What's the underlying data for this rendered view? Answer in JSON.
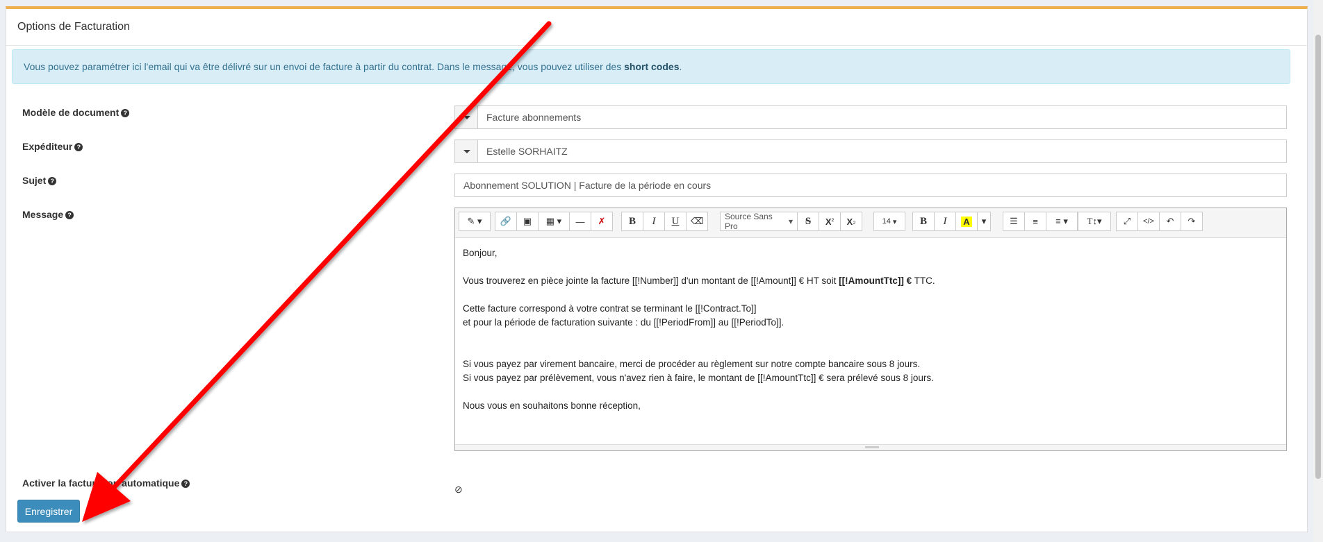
{
  "panel": {
    "title": "Options de Facturation"
  },
  "alert": {
    "text": "Vous pouvez paramétrer ici l'email qui va être délivré sur un envoi de facture à partir du contrat. Dans le message, vous pouvez utiliser des",
    "link": "short codes",
    "end": "."
  },
  "form": {
    "modele_label": "Modèle de document",
    "modele_value": "Facture abonnements",
    "expediteur_label": "Expéditeur",
    "expediteur_value": "Estelle SORHAITZ",
    "sujet_label": "Sujet",
    "sujet_value": "Abonnement SOLUTION | Facture de la période en cours",
    "message_label": "Message",
    "auto_label": "Activer la facturation automatique",
    "auto_icon": "ban-icon",
    "save_label": "Enregistrer"
  },
  "toolbar": {
    "font_name": "Source Sans Pro",
    "font_size": "14",
    "bold": "B",
    "italic": "I",
    "underline": "U",
    "strike": "S",
    "highlight": "A",
    "text_height": "T↕"
  },
  "message": {
    "line1": "Bonjour,",
    "line2_a": "Vous trouverez en pièce jointe la facture [[!Number]] d'un montant de  [[!Amount]] € HT soit ",
    "line2_b": "[[!AmountTtc]] €",
    "line2_c": " TTC.",
    "line3": "Cette facture correspond à votre contrat se terminant le [[!Contract.To]]",
    "line4": "et pour la période de facturation suivante : du [[!PeriodFrom]] au [[!PeriodTo]].",
    "line5": "Si vous payez par virement bancaire, merci de procéder au règlement sur notre compte bancaire sous 8 jours.",
    "line6": "Si vous payez par prélèvement, vous n'avez rien à faire, le montant de [[!AmountTtc]] € sera prélevé sous 8 jours.",
    "line7": "Nous vous en souhaitons bonne réception,"
  },
  "colors": {
    "accent": "#f0ad4e",
    "primary": "#3c8dbc",
    "arrow": "#ff0000",
    "alert_bg": "#d9edf7"
  }
}
